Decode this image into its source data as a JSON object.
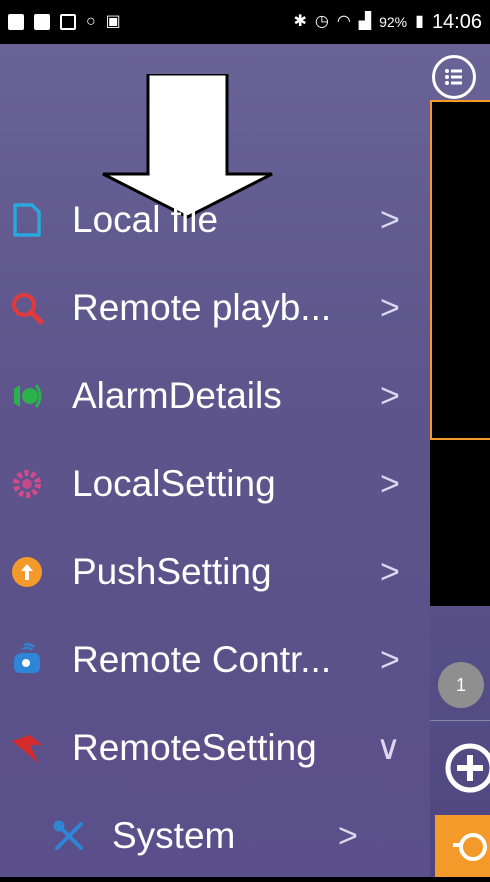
{
  "status_bar": {
    "battery": "92%",
    "time": "14:06"
  },
  "menu": {
    "items": [
      {
        "label": "Local file",
        "icon": "file-icon",
        "chevron": ">"
      },
      {
        "label": "Remote playb...",
        "icon": "search-icon",
        "chevron": ">"
      },
      {
        "label": "AlarmDetails",
        "icon": "alarm-icon",
        "chevron": ">"
      },
      {
        "label": "LocalSetting",
        "icon": "gear-icon",
        "chevron": ">"
      },
      {
        "label": "PushSetting",
        "icon": "push-icon",
        "chevron": ">"
      },
      {
        "label": "Remote Contr...",
        "icon": "remote-control-icon",
        "chevron": ">"
      },
      {
        "label": "RemoteSetting",
        "icon": "remote-setting-icon",
        "chevron": "∨"
      }
    ],
    "sub_items": [
      {
        "label": "System",
        "icon": "tools-icon",
        "chevron": ">"
      }
    ]
  },
  "right_pane": {
    "page_badge": "1"
  },
  "colors": {
    "accent": "#f39a2b",
    "drawer_bg": "#5d558b"
  }
}
